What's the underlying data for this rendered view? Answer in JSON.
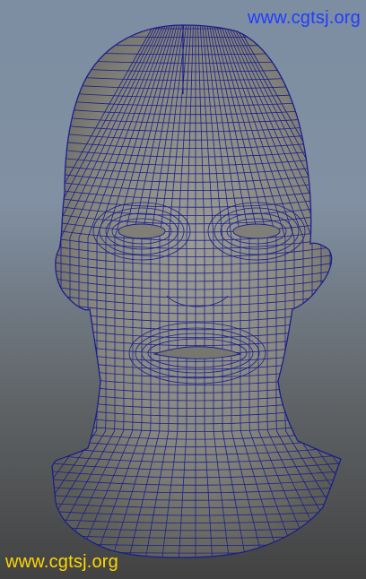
{
  "viewport": {
    "background_top": "#7d8ea2",
    "background_bottom": "#424242",
    "mesh_fill": "#8b8b84",
    "wire_color": "#1a1f8c"
  },
  "model": {
    "icon": "head-wireframe-mesh"
  },
  "watermark_top": {
    "text": "www.cgtsj.org",
    "color": "#1f3cff"
  },
  "watermark_bottom": {
    "text": "www.cgtsj.org",
    "color": "#ffd800"
  }
}
